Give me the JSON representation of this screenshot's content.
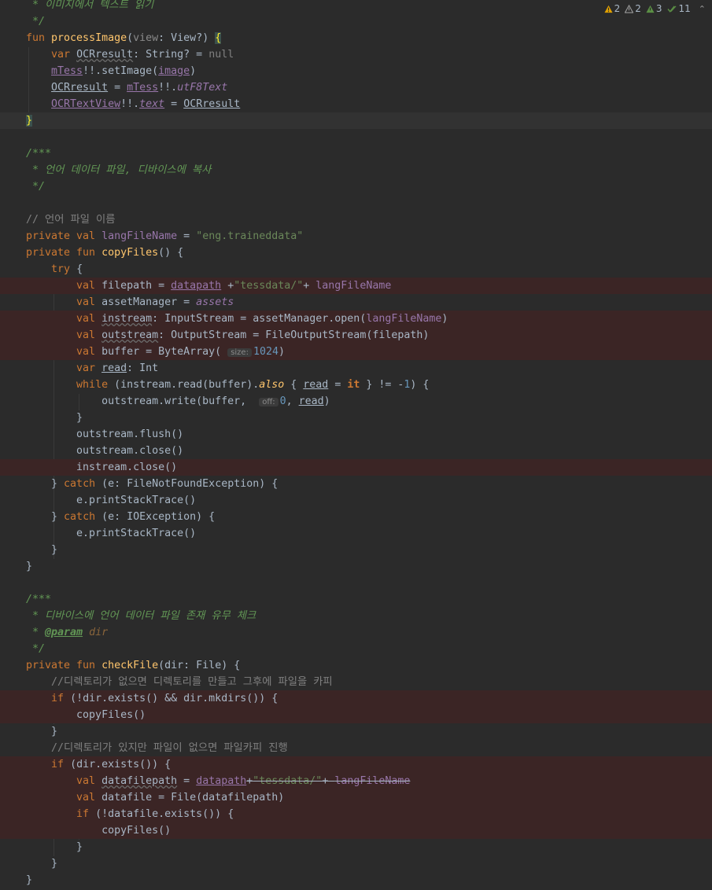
{
  "inspections": [
    {
      "icon": "error-icon",
      "count": "2",
      "color": "#e0a000"
    },
    {
      "icon": "warning-icon",
      "count": "2",
      "color": "#9a9a9a"
    },
    {
      "icon": "weak-warning-icon",
      "count": "3",
      "color": "#5b8f45"
    },
    {
      "icon": "typo-icon",
      "count": "11",
      "color": "#5b8f45"
    }
  ],
  "code": {
    "l0": " * 이미지에서 텍스트 읽기",
    "l1": " */",
    "l16": "// 언어 파일 이름",
    "l36": " * 디바이스에 언어 데이터 파일 존재 유무 체크",
    "l40": "//디렉토리가 없으면 디렉토리를 만들고 그후에 파일을 카피",
    "l44": "//디렉토리가 있지만 파일이 없으면 파일카피 진행",
    "l12": " * 언어 데이터 파일, 디바이스에 복사",
    "lang_file": "\"eng.traineddata\"",
    "tessdata": "\"tessdata/\"",
    "hint_size": "size:",
    "hint_off": "off:",
    "num_1024": "1024",
    "num_0": "0",
    "num_1": "1"
  }
}
